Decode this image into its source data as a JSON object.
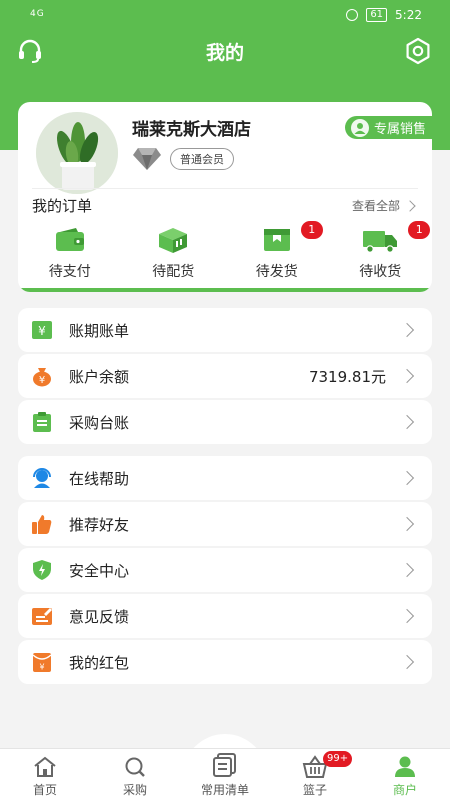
{
  "status_bar": {
    "signal": "4G",
    "battery": "61",
    "time": "5:22"
  },
  "header": {
    "title": "我的"
  },
  "profile": {
    "store_name": "瑞莱克斯大酒店",
    "member_level": "普通会员",
    "sales_rep_label": "专属销售"
  },
  "orders": {
    "title": "我的订单",
    "view_all": "查看全部",
    "items": [
      {
        "label": "待支付",
        "icon": "wallet-icon",
        "count": ""
      },
      {
        "label": "待配货",
        "icon": "box-icon",
        "count": ""
      },
      {
        "label": "待发货",
        "icon": "package-icon",
        "count": "1"
      },
      {
        "label": "待收货",
        "icon": "truck-icon",
        "count": "1"
      }
    ]
  },
  "menu_group_1": [
    {
      "label": "账期账单",
      "icon": "bill-icon",
      "value": ""
    },
    {
      "label": "账户余额",
      "icon": "money-bag-icon",
      "value": "7319.81元"
    },
    {
      "label": "采购台账",
      "icon": "clipboard-icon",
      "value": ""
    }
  ],
  "menu_group_2": [
    {
      "label": "在线帮助",
      "icon": "headset-icon"
    },
    {
      "label": "推荐好友",
      "icon": "thumbs-up-icon"
    },
    {
      "label": "安全中心",
      "icon": "shield-icon"
    },
    {
      "label": "意见反馈",
      "icon": "feedback-icon"
    },
    {
      "label": "我的红包",
      "icon": "red-envelope-icon"
    }
  ],
  "tabbar": {
    "items": [
      {
        "label": "首页",
        "icon": "home-icon"
      },
      {
        "label": "采购",
        "icon": "search-icon"
      },
      {
        "label": "常用清单",
        "icon": "list-icon"
      },
      {
        "label": "篮子",
        "icon": "basket-icon",
        "badge": "99+"
      },
      {
        "label": "商户",
        "icon": "user-icon"
      }
    ],
    "active": "商户"
  },
  "colors": {
    "primary": "#5cbd4f",
    "badge_red": "#e21a23",
    "orange": "#f07a2b",
    "blue": "#1e88e5"
  }
}
